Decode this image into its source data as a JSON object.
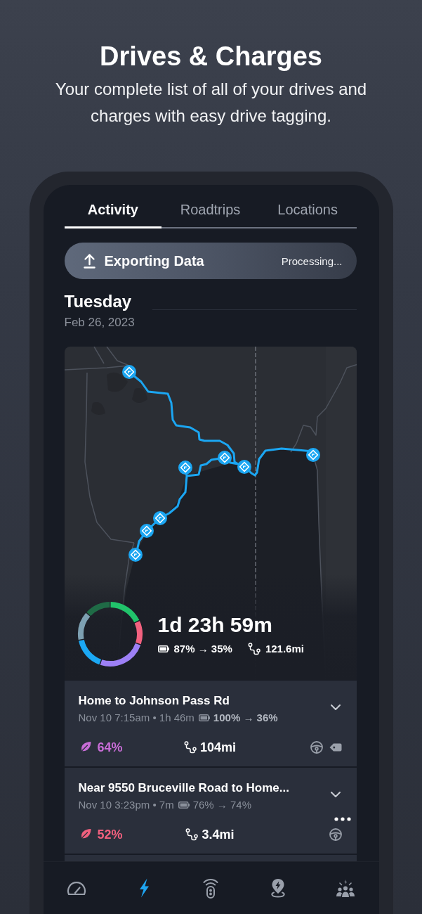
{
  "header": {
    "title": "Drives & Charges",
    "subtitle": "Your complete list of all of your drives and charges with easy drive tagging."
  },
  "tabs": [
    {
      "label": "Activity",
      "selected": true
    },
    {
      "label": "Roadtrips",
      "selected": false
    },
    {
      "label": "Locations",
      "selected": false
    }
  ],
  "export_banner": {
    "title": "Exporting Data",
    "status": "Processing..."
  },
  "day": {
    "weekday": "Tuesday",
    "date": "Feb 26, 2023"
  },
  "summary": {
    "duration": "1d 23h 59m",
    "battery": "87% → 35%",
    "distance": "121.6mi"
  },
  "drives": [
    {
      "title": "Home to Johnson Pass Rd",
      "meta": "Nov 10 7:15am • 1h 46m",
      "battery": "100% → 36%",
      "battery_emphasized": true,
      "expanded": false,
      "efficiency": "64%",
      "color": "#c86dd7",
      "distance": "104mi",
      "tagged": true,
      "more_button": false
    },
    {
      "title": "Near 9550 Bruceville Road to Home...",
      "meta": "Nov 10 3:23pm • 7m",
      "battery": "76% → 74%",
      "battery_emphasized": false,
      "expanded": false,
      "efficiency": "52%",
      "color": "#f0607e",
      "distance": "3.4mi",
      "tagged": false,
      "more_button": true
    }
  ],
  "nav": [
    {
      "kind": "gauge",
      "selected": false
    },
    {
      "kind": "lightning",
      "selected": true
    },
    {
      "kind": "key-fob",
      "selected": false
    },
    {
      "kind": "charger-pin",
      "selected": false
    },
    {
      "kind": "community",
      "selected": false
    }
  ]
}
